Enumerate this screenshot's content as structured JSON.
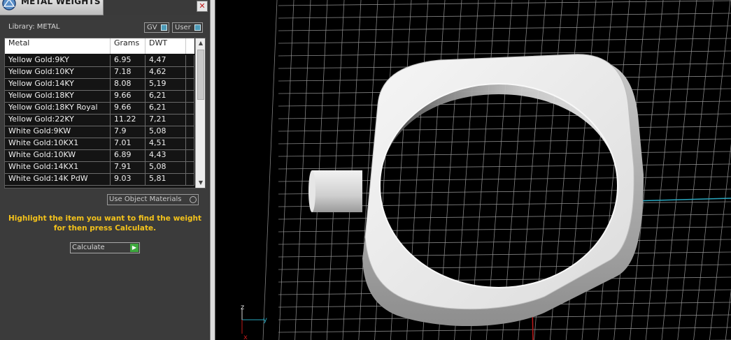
{
  "panel": {
    "title": "METAL WEIGHTS",
    "close_label": "✕",
    "library_label": "Library: METAL",
    "gv_label": "GV",
    "user_label": "User",
    "table": {
      "headers": [
        "Metal",
        "Grams",
        "DWT"
      ],
      "rows": [
        [
          "Yellow Gold:9KY",
          "6.95",
          "4,47"
        ],
        [
          "Yellow Gold:10KY",
          "7.18",
          "4,62"
        ],
        [
          "Yellow Gold:14KY",
          "8.08",
          "5,19"
        ],
        [
          "Yellow Gold:18KY",
          "9.66",
          "6,21"
        ],
        [
          "Yellow Gold:18KY Royal",
          "9.66",
          "6,21"
        ],
        [
          "Yellow Gold:22KY",
          "11.22",
          "7,21"
        ],
        [
          "White Gold:9KW",
          "7.9",
          "5,08"
        ],
        [
          "White Gold:10KX1",
          "7.01",
          "4,51"
        ],
        [
          "White Gold:10KW",
          "6.89",
          "4,43"
        ],
        [
          "White Gold:14KX1",
          "7.91",
          "5,08"
        ],
        [
          "White Gold:14K PdW",
          "9.03",
          "5,81"
        ]
      ]
    },
    "use_object_label": "Use Object Materials",
    "hint_text": "Highlight the item you want to find the weight for then press Calculate.",
    "calculate_label": "Calculate"
  },
  "viewport": {
    "axis_labels": {
      "z": "z",
      "y": "y",
      "x": "x"
    },
    "colors": {
      "grid": "#9a9a9a",
      "axis_x": "#c01a1a",
      "axis_y": "#2aa8c0",
      "ring": "#e8e8e8"
    }
  }
}
